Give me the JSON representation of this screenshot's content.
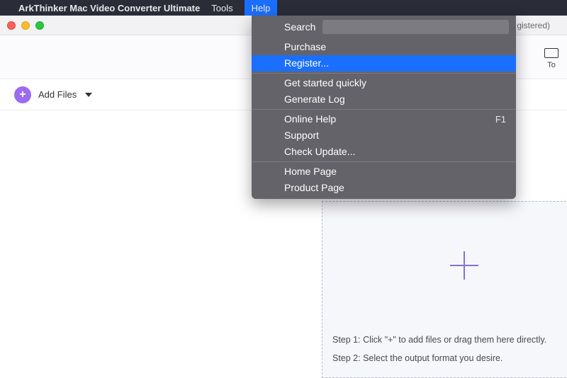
{
  "menubar": {
    "app_name": "ArkThinker Mac Video Converter Ultimate",
    "items": [
      "Tools",
      "Help"
    ],
    "active_index": 1
  },
  "window": {
    "reg_hint_fragment": "gistered)"
  },
  "toolbox_right": {
    "label_fragment": "To"
  },
  "addfiles": {
    "label": "Add Files"
  },
  "help_menu": {
    "search_label": "Search",
    "search_value": "",
    "groups": [
      {
        "items": [
          {
            "label": "Purchase"
          },
          {
            "label": "Register...",
            "highlight": true
          }
        ]
      },
      {
        "items": [
          {
            "label": "Get started quickly"
          },
          {
            "label": "Generate Log"
          }
        ]
      },
      {
        "items": [
          {
            "label": "Online Help",
            "shortcut": "F1"
          },
          {
            "label": "Support"
          },
          {
            "label": "Check Update..."
          }
        ]
      },
      {
        "items": [
          {
            "label": "Home Page"
          },
          {
            "label": "Product Page"
          }
        ]
      }
    ]
  },
  "dropzone": {
    "step1": "Step 1: Click \"+\" to add files or drag them here directly.",
    "step2": "Step 2: Select the output format you desire."
  }
}
